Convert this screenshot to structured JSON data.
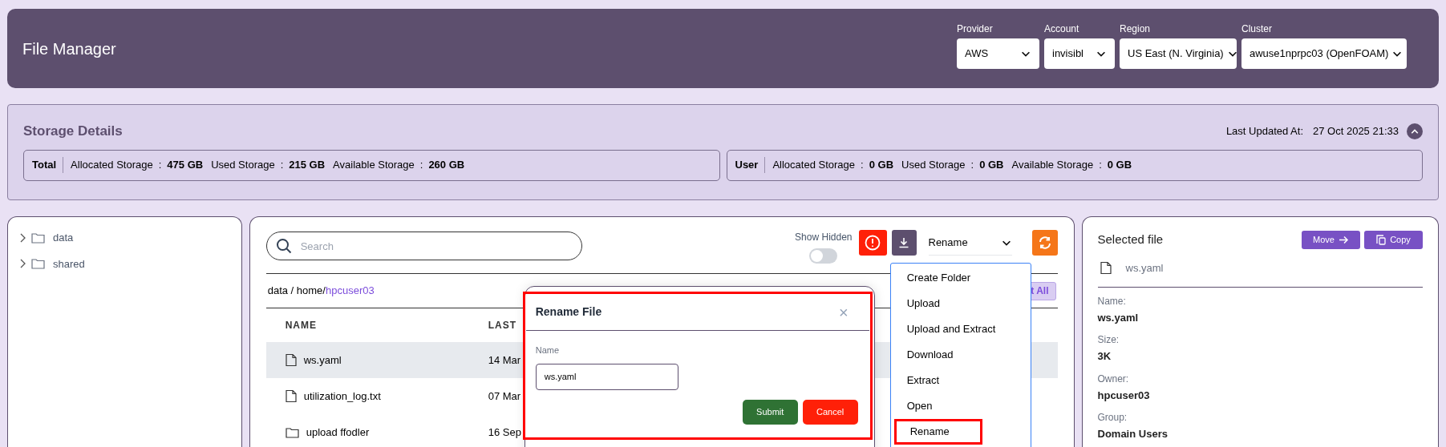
{
  "header": {
    "title": "File Manager",
    "selectors": [
      {
        "label": "Provider",
        "value": "AWS"
      },
      {
        "label": "Account",
        "value": "invisibl"
      },
      {
        "label": "Region",
        "value": "US East (N. Virginia)"
      },
      {
        "label": "Cluster",
        "value": "awuse1nprpc03 (OpenFOAM)"
      }
    ]
  },
  "storage": {
    "title": "Storage Details",
    "separator": ":",
    "updated_label": "Last Updated At:",
    "updated_value": "27 Oct 2025 21:33",
    "expanded": true,
    "groups": [
      {
        "name": "Total",
        "stats": [
          {
            "label": "Allocated Storage",
            "value": "475 GB"
          },
          {
            "label": "Used Storage",
            "value": "215 GB"
          },
          {
            "label": "Available Storage",
            "value": "260 GB"
          }
        ]
      },
      {
        "name": "User",
        "stats": [
          {
            "label": "Allocated Storage",
            "value": "0 GB"
          },
          {
            "label": "Used Storage",
            "value": "0 GB"
          },
          {
            "label": "Available Storage",
            "value": "0 GB"
          }
        ]
      }
    ]
  },
  "tree": [
    {
      "label": "data",
      "expanded": false
    },
    {
      "label": "shared",
      "expanded": false
    }
  ],
  "browser": {
    "search_placeholder": "Search",
    "show_hidden": {
      "label": "Show Hidden",
      "on": false
    },
    "action_select": "Rename",
    "path": "data / home/",
    "current": "hpcuser03",
    "select_all": "t All",
    "columns": [
      "NAME",
      "LAST"
    ],
    "rows": [
      {
        "kind": "file",
        "name": "ws.yaml",
        "date": "14 Mar",
        "selected": true
      },
      {
        "kind": "file",
        "name": "utilization_log.txt",
        "date": "07 Mar",
        "selected": false
      },
      {
        "kind": "folder",
        "name": "upload ffodler",
        "date": "16 Sep",
        "selected": false
      }
    ]
  },
  "action_menu": {
    "items": [
      {
        "label": "Create Folder",
        "selected": false
      },
      {
        "label": "Upload",
        "selected": false
      },
      {
        "label": "Upload and Extract",
        "selected": false
      },
      {
        "label": "Download",
        "selected": false
      },
      {
        "label": "Extract",
        "selected": false
      },
      {
        "label": "Open",
        "selected": false
      },
      {
        "label": "Rename",
        "selected": true
      }
    ]
  },
  "dialog": {
    "title": "Rename File",
    "close": "×",
    "field_label": "Name",
    "field_value": "ws.yaml",
    "buttons": [
      {
        "kind": "primary",
        "label": "Submit"
      },
      {
        "kind": "danger",
        "label": "Cancel"
      }
    ]
  },
  "details": {
    "title": "Selected file",
    "buttons": [
      {
        "kind": "move",
        "label": "Move"
      },
      {
        "kind": "copy",
        "label": "Copy"
      }
    ],
    "file_name": "ws.yaml",
    "fields": [
      {
        "label": "Name:",
        "value": "ws.yaml"
      },
      {
        "label": "Size:",
        "value": "3K"
      },
      {
        "label": "Owner:",
        "value": "hpcuser03"
      },
      {
        "label": "Group:",
        "value": "Domain Users"
      }
    ]
  }
}
